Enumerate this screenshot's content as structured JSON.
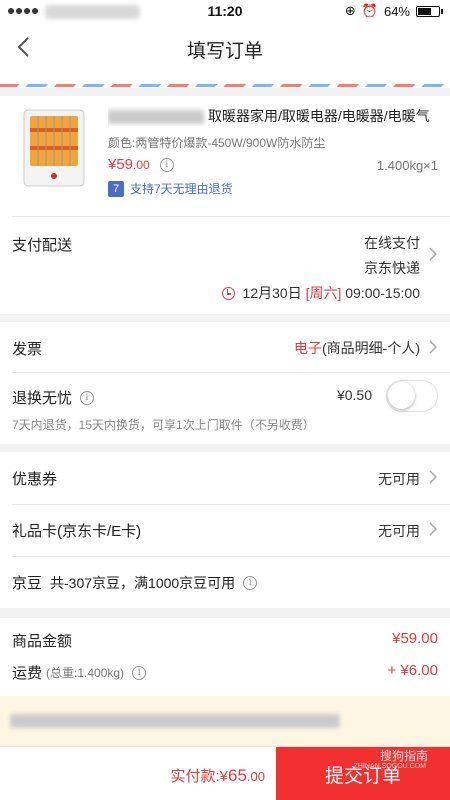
{
  "status_bar": {
    "time": "11:20",
    "battery": "64%",
    "battery_level": 0.64
  },
  "nav": {
    "title": "填写订单",
    "back_icon": "back-arrow-icon"
  },
  "product": {
    "title": "取暖器家用/取暖电器/电暖器/电暖气",
    "spec": "颜色:两管特价爆款-450W/900W防水防尘",
    "price_symbol": "¥",
    "price_int": "59",
    "price_dec": ".00",
    "weight": "1.400kg×1",
    "return_badge_num": "7",
    "return_text": "支持7天无理由退货"
  },
  "payment": {
    "label": "支付配送",
    "pay_method": "在线支付",
    "delivery": "京东快递",
    "date": "12月30日",
    "weekday": "[周六]",
    "time_slot": "09:00-15:00"
  },
  "invoice": {
    "label": "发票",
    "type": "电子",
    "detail": "(商品明细-个人)"
  },
  "worry_free": {
    "label": "退换无忧",
    "price": "¥0.50",
    "desc": "7天内退货，15天内换货，可享1次上门取件（不另收费）",
    "enabled": false
  },
  "coupon": {
    "label": "优惠券",
    "value": "无可用"
  },
  "giftcard": {
    "label": "礼品卡(京东卡/E卡)",
    "value": "无可用"
  },
  "jingdou": {
    "label": "京豆",
    "text": "共-307京豆，满1000京豆可用"
  },
  "totals": {
    "goods_label": "商品金额",
    "goods_amount": "¥59.00",
    "freight_label": "运费",
    "freight_weight": "(总重:1.400kg)",
    "freight_amount": "+ ¥6.00"
  },
  "bottom": {
    "pay_label": "实付款:",
    "pay_symbol": "¥",
    "pay_int": "65",
    "pay_dec": ".00",
    "submit": "提交订单",
    "watermark": "搜狗指南",
    "watermark_sub": "ZHINAN.SOGOU.COM"
  },
  "colors": {
    "accent": "#e4393c",
    "submit_bg": "#f23030",
    "badge_blue": "#4a6ec6"
  }
}
